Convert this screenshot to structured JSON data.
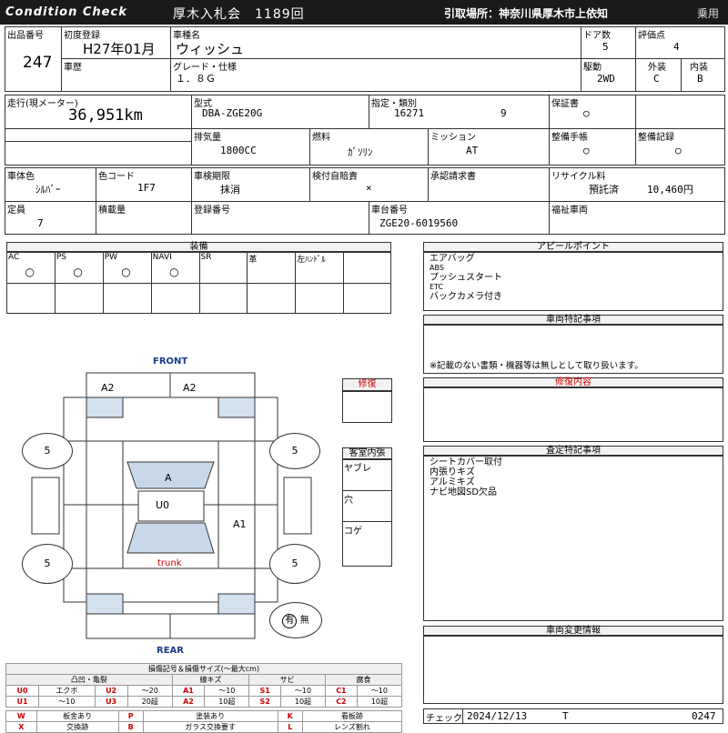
{
  "header": {
    "brand": "Condition  Check",
    "auction": "厚木入札会　1189回",
    "pickup": "引取場所：神奈川県厚木市上依知",
    "category": "乗用"
  },
  "row1": {
    "lot_label": "出品番号",
    "lot": "247",
    "first_reg_label": "初度登録",
    "first_reg": "H27年01月",
    "model_name_label": "車種名",
    "model_name": "ウィッシュ",
    "doors_label": "ドア数",
    "doors": "5",
    "score_label": "評価点",
    "score": "4",
    "history_label": "車歴",
    "grade_label": "グレード・仕様",
    "grade": "１．８Ｇ",
    "drive_label": "駆動",
    "drive": "2WD",
    "ext_label": "外装",
    "ext": "C",
    "int_label": "内装",
    "int": "B"
  },
  "row2": {
    "mileage_label": "走行(現メーター)",
    "mileage": "36,951km",
    "type_label": "型式",
    "type": "DBA-ZGE20G",
    "designation_label": "指定・類別",
    "designation": "16271",
    "classification": "9",
    "warranty_label": "保証書",
    "warranty": "○",
    "disp_label": "排気量",
    "disp": "1800CC",
    "fuel_label": "燃料",
    "fuel": "ｶﾞｿﾘﾝ",
    "mission_label": "ミッション",
    "mission": "AT",
    "manual_label": "整備手帳",
    "manual": "○",
    "record_label": "整備記録",
    "record": "○"
  },
  "row3": {
    "color_label": "車体色",
    "color": "ｼﾙﾊﾞｰ",
    "code_label": "色コード",
    "code": "1F7",
    "inspection_label": "車検期限",
    "inspection": "抹消",
    "insurance_label": "検付自賠責",
    "insurance": "×",
    "approval_label": "承認請求書",
    "recycle_label": "リサイクル料",
    "recycle_status": "預託済",
    "recycle_fee": "10,460円",
    "capacity_label": "定員",
    "capacity": "7",
    "load_label": "積載量",
    "reg_label": "登録番号",
    "chassis_label": "車台番号",
    "chassis": "ZGE20-6019560",
    "welfare_label": "福祉車両"
  },
  "equipment": {
    "title": "装備",
    "items": [
      {
        "name": "AC",
        "mark": "○"
      },
      {
        "name": "PS",
        "mark": "○"
      },
      {
        "name": "PW",
        "mark": "○"
      },
      {
        "name": "NAVI",
        "mark": "○"
      },
      {
        "name": "SR",
        "mark": ""
      },
      {
        "name": "革",
        "mark": ""
      },
      {
        "name": "左ﾊﾝﾄﾞﾙ",
        "mark": ""
      }
    ]
  },
  "appeal": {
    "title": "アピールポイント",
    "lines": [
      "エアバッグ",
      "ABS",
      "プッシュスタート",
      "ETC",
      "バックカメラ付き"
    ]
  },
  "special": {
    "title": "車両特記事項",
    "note": "※記載のない書類・機器等は無しとして取り扱います。"
  },
  "repair": {
    "title": "修復内容"
  },
  "inspect_notes": {
    "title": "査定特記事項",
    "lines": [
      "シートカバー取付",
      "内張りキズ",
      "アルミキズ",
      "ナビ地図SD欠品"
    ]
  },
  "change_info": {
    "title": "車両変更情報"
  },
  "diagram": {
    "front": "FRONT",
    "rear": "REAR",
    "marks": {
      "a2_left": "A2",
      "a2_right": "A2",
      "hood": "A",
      "roof": "U0",
      "side": "A1",
      "trunk": "trunk",
      "tire_fl": "5",
      "tire_fr": "5",
      "tire_rl": "5",
      "tire_rr": "5"
    },
    "spare_has": "有",
    "spare_none": "無"
  },
  "repair_box": {
    "title": "修復"
  },
  "cabin": {
    "title": "客室内張",
    "items": [
      "ヤブレ",
      "穴",
      "コゲ"
    ]
  },
  "legend": {
    "title": "損傷記号＆損傷サイズ(〜最大cm)",
    "groups": [
      "凸凹・亀裂",
      "線キズ",
      "サビ",
      "腐食"
    ],
    "rows": [
      [
        [
          "U0",
          "エクボ"
        ],
        [
          "U2",
          "〜20"
        ],
        [
          "A1",
          "〜10"
        ],
        [
          "S1",
          "〜10"
        ],
        [
          "C1",
          "〜10"
        ]
      ],
      [
        [
          "U1",
          "〜10"
        ],
        [
          "U3",
          "20超"
        ],
        [
          "A2",
          "10超"
        ],
        [
          "S2",
          "10超"
        ],
        [
          "C2",
          "10超"
        ]
      ]
    ],
    "sym_rows": [
      [
        [
          "W",
          "板金あり"
        ],
        [
          "P",
          "塗装あり"
        ],
        [
          "K",
          "看板跡"
        ]
      ],
      [
        [
          "X",
          "交換跡"
        ],
        [
          "B",
          "ガラス交換要す"
        ],
        [
          "L",
          "レンズ割れ"
        ]
      ]
    ],
    "u1_label": "〜10"
  },
  "footer": {
    "check_label": "チェック",
    "date": "2024/12/13",
    "inspector": "T",
    "code": "0247"
  }
}
